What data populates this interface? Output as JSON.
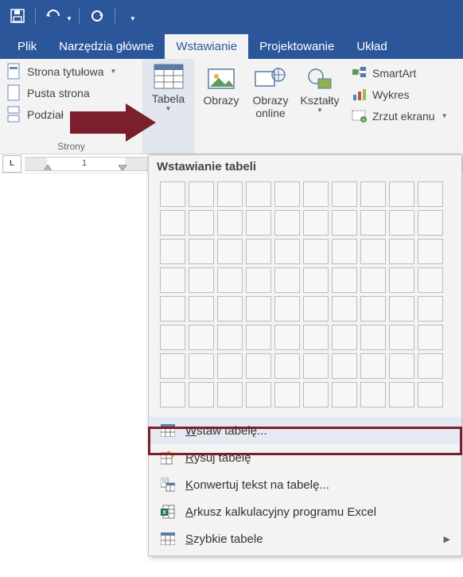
{
  "qat": {
    "save": "save",
    "undo": "undo",
    "redo": "redo"
  },
  "tabs": {
    "file": "Plik",
    "home": "Narzędzia główne",
    "insert": "Wstawianie",
    "design": "Projektowanie",
    "layout": "Układ"
  },
  "pages": {
    "cover": "Strona tytułowa",
    "blank": "Pusta strona",
    "break": "Podział",
    "group_label": "Strony"
  },
  "table_btn": {
    "label": "Tabela"
  },
  "illus": {
    "pictures": "Obrazy",
    "online_l1": "Obrazy",
    "online_l2": "online",
    "shapes": "Kształty"
  },
  "extras": {
    "smartart": "SmartArt",
    "chart": "Wykres",
    "screenshot": "Zrzut ekranu"
  },
  "ruler": {
    "one": "1"
  },
  "dropdown": {
    "header": "Wstawianie tabeli",
    "insert_pre": "W",
    "insert_rest": "staw tabelę...",
    "draw_pre": "R",
    "draw_rest": "ysuj tabelę",
    "convert_pre": "K",
    "convert_rest": "onwertuj tekst na tabelę...",
    "excel_pre": "A",
    "excel_rest": "rkusz kalkulacyjny programu Excel",
    "quick_pre": "S",
    "quick_rest": "zybkie tabele"
  }
}
